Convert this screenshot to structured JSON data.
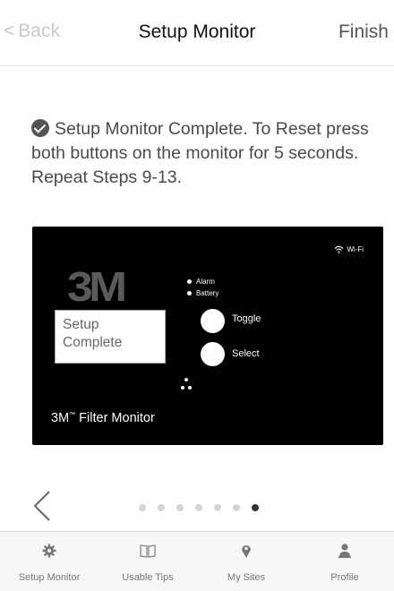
{
  "nav": {
    "back_label": "Back",
    "title": "Setup Monitor",
    "finish_label": "Finish"
  },
  "message": {
    "text": "Setup Monitor Complete. To Reset press both buttons on the monitor for 5 seconds. Repeat Steps 9-13."
  },
  "monitor": {
    "logo": "3M",
    "wifi_label": "Wi-Fi",
    "alarm_label": "Alarm",
    "battery_label": "Battery",
    "screen_text_line1": "Setup",
    "screen_text_line2": "Complete",
    "toggle_label": "Toggle",
    "select_label": "Select",
    "brand": "3M",
    "brand_tm": "™",
    "brand_rest": " Filter Monitor"
  },
  "pager": {
    "total": 7,
    "current": 7
  },
  "tabs": [
    {
      "label": "Setup Monitor",
      "icon": "gear-icon"
    },
    {
      "label": "Usable Tips",
      "icon": "book-icon"
    },
    {
      "label": "My Sites",
      "icon": "map-pin-icon"
    },
    {
      "label": "Profile",
      "icon": "user-icon"
    }
  ],
  "colors": {
    "text": "#4a4a4a",
    "panel": "#000000",
    "inactive": "#c7c7c7",
    "active_dot": "#333333"
  }
}
